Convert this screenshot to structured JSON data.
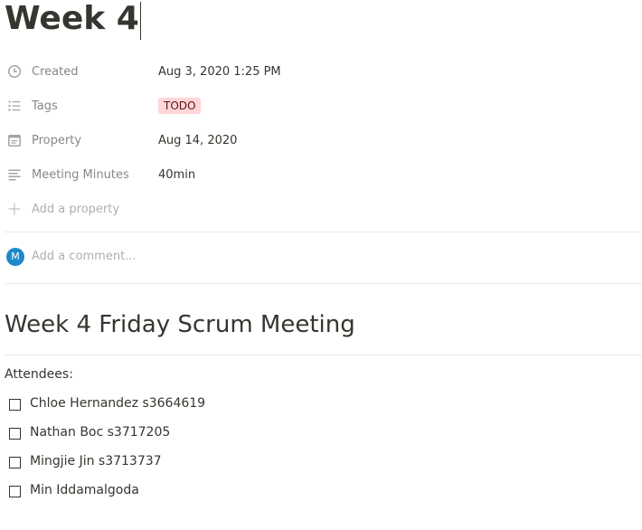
{
  "page": {
    "title": "Week 4"
  },
  "properties": [
    {
      "icon": "clock-icon",
      "name": "Created",
      "value": "Aug 3, 2020 1:25 PM"
    },
    {
      "icon": "list-icon",
      "name": "Tags",
      "value": "TODO"
    },
    {
      "icon": "calendar-icon",
      "name": "Property",
      "value": "Aug 14, 2020"
    },
    {
      "icon": "text-lines-icon",
      "name": "Meeting Minutes",
      "value": "40min"
    }
  ],
  "add_property": {
    "icon": "plus-icon",
    "label": "Add a property"
  },
  "comment": {
    "avatar_initial": "M",
    "placeholder": "Add a comment..."
  },
  "content": {
    "heading": "Week 4 Friday Scrum Meeting",
    "attendees_label": "Attendees:",
    "todos": [
      {
        "text": "Chloe Hernandez s3664619",
        "checked": false
      },
      {
        "text": "Nathan Boc s3717205",
        "checked": false
      },
      {
        "text": "Mingjie Jin s3713737",
        "checked": false
      },
      {
        "text": "Min Iddamalgoda",
        "checked": false
      }
    ]
  },
  "colors": {
    "text": "#37352f",
    "tag_bg": "#ffd5d8",
    "avatar_bg": "#1e88c8",
    "divider": "#e9e9e7"
  }
}
